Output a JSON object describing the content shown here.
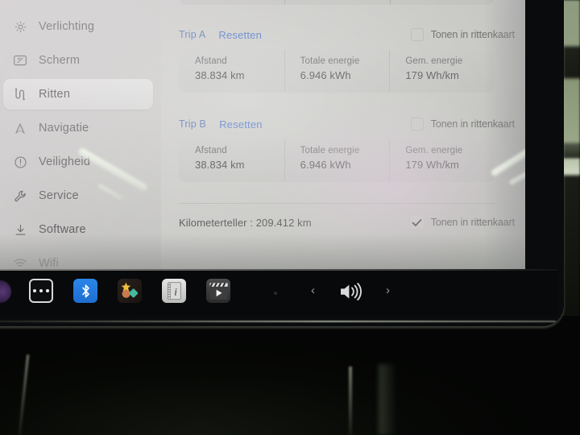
{
  "sidebar": {
    "items": [
      {
        "label": "Verlichting",
        "icon": "brightness-icon",
        "selected": false,
        "faded": false
      },
      {
        "label": "Scherm",
        "icon": "display-icon",
        "selected": false,
        "faded": false
      },
      {
        "label": "Ritten",
        "icon": "trips-road-icon",
        "selected": true,
        "faded": false
      },
      {
        "label": "Navigatie",
        "icon": "navigation-arrow-icon",
        "selected": false,
        "faded": false
      },
      {
        "label": "Veiligheid",
        "icon": "warning-circle-icon",
        "selected": false,
        "faded": false
      },
      {
        "label": "Service",
        "icon": "wrench-icon",
        "selected": false,
        "faded": false
      },
      {
        "label": "Software",
        "icon": "download-icon",
        "selected": false,
        "faded": false
      },
      {
        "label": "Wifi",
        "icon": "wifi-icon",
        "selected": false,
        "faded": true
      }
    ]
  },
  "content": {
    "columns": [
      "Afstand",
      "Totale energie",
      "Gem. energie"
    ],
    "trips": [
      {
        "name": "Trip A",
        "reset_label": "Resetten",
        "show_on_map_label": "Tonen in rittenkaart",
        "show_on_map_checked": false,
        "stats": [
          {
            "label": "Afstand",
            "value": "38.834 km"
          },
          {
            "label": "Totale energie",
            "value": "6.946 kWh"
          },
          {
            "label": "Gem. energie",
            "value": "179 Wh/km"
          }
        ]
      },
      {
        "name": "Trip B",
        "reset_label": "Resetten",
        "show_on_map_label": "Tonen in rittenkaart",
        "show_on_map_checked": false,
        "stats": [
          {
            "label": "Afstand",
            "value": "38.834 km"
          },
          {
            "label": "Totale energie",
            "value": "6.946 kWh"
          },
          {
            "label": "Gem. energie",
            "value": "179 Wh/km"
          }
        ]
      }
    ],
    "odometer": {
      "label": "Kilometerteller",
      "separator": ":",
      "value": "209.412 km",
      "text": "Kilometerteller : 209.412 km",
      "show_on_map_label": "Tonen in rittenkaart",
      "show_on_map_checked": true
    }
  },
  "taskbar": {
    "items": [
      {
        "name": "more-dots-icon",
        "label": ""
      },
      {
        "name": "bluetooth-icon",
        "label": ""
      },
      {
        "name": "apps-icon",
        "label": ""
      },
      {
        "name": "manual-info-icon",
        "label": ""
      },
      {
        "name": "media-player-icon",
        "label": ""
      }
    ],
    "volume_prev_label": "‹",
    "volume_next_label": "›",
    "volume_icon": "speaker-volume-icon"
  },
  "colors": {
    "link": "#2f62c4",
    "trip_name": "#3b5fa8",
    "screen_bg": "#c9c9c6",
    "card_bg": "#c4c4c2",
    "text": "#2e2e30",
    "taskbar_bg": "#08090a",
    "bluetooth": "#2b86e8"
  }
}
